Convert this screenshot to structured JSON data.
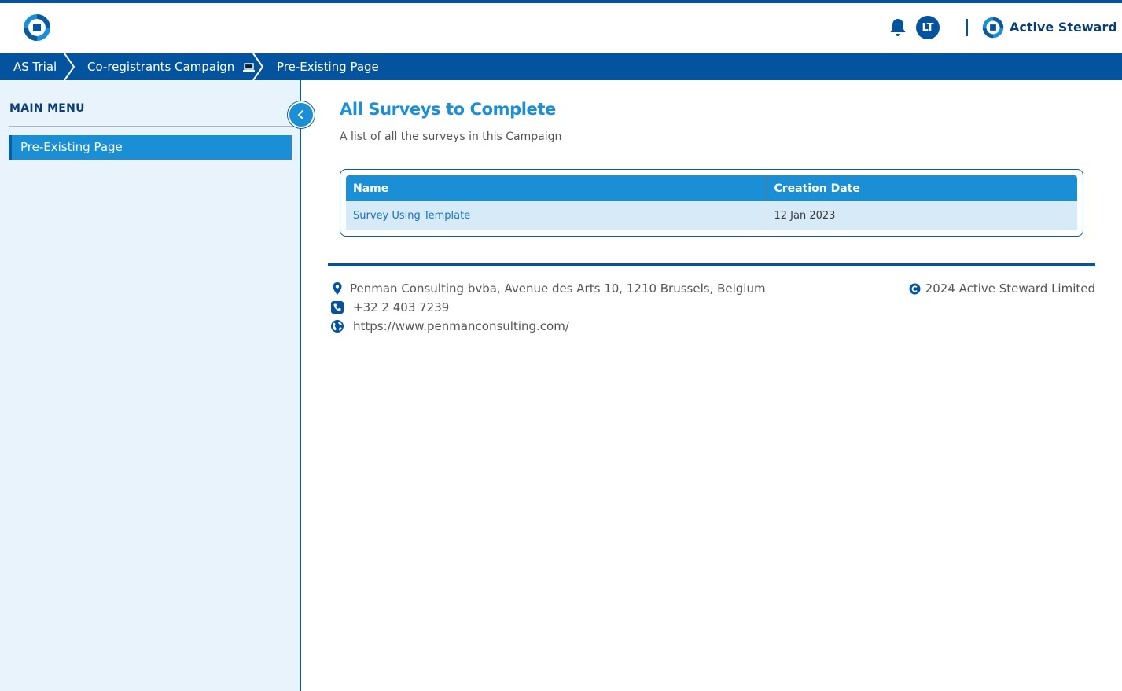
{
  "header": {
    "user_initials": "LT",
    "brand_name": "Active Steward",
    "icons": [
      "app-logo-icon",
      "bell-icon",
      "brand-logo-icon"
    ],
    "colors": {
      "primary": "#03539e",
      "accent": "#1a8fd6",
      "sidebar_bg": "#e8f3fb"
    }
  },
  "breadcrumb": [
    {
      "label": "AS Trial"
    },
    {
      "label": "Co-registrants Campaign",
      "icon": "laptop-icon"
    },
    {
      "label": "Pre-Existing Page"
    }
  ],
  "sidebar": {
    "title": "MAIN MENU",
    "items": [
      {
        "label": "Pre-Existing Page",
        "active": true
      }
    ],
    "collapse_icon": "chevron-left-icon"
  },
  "main": {
    "title": "All Surveys to Complete",
    "subtitle": "A list of all the surveys in this Campaign",
    "table": {
      "columns": [
        "Name",
        "Creation Date"
      ],
      "rows": [
        {
          "name": "Survey Using Template",
          "date": "12 Jan 2023"
        }
      ]
    }
  },
  "footer": {
    "address": "Penman Consulting bvba, Avenue des Arts 10, 1210 Brussels, Belgium",
    "phone": "+32 2 403 7239",
    "website": "https://www.penmanconsulting.com/",
    "copyright": "2024 Active Steward Limited",
    "icons": [
      "location-pin-icon",
      "phone-icon",
      "globe-icon",
      "copyright-icon"
    ]
  }
}
